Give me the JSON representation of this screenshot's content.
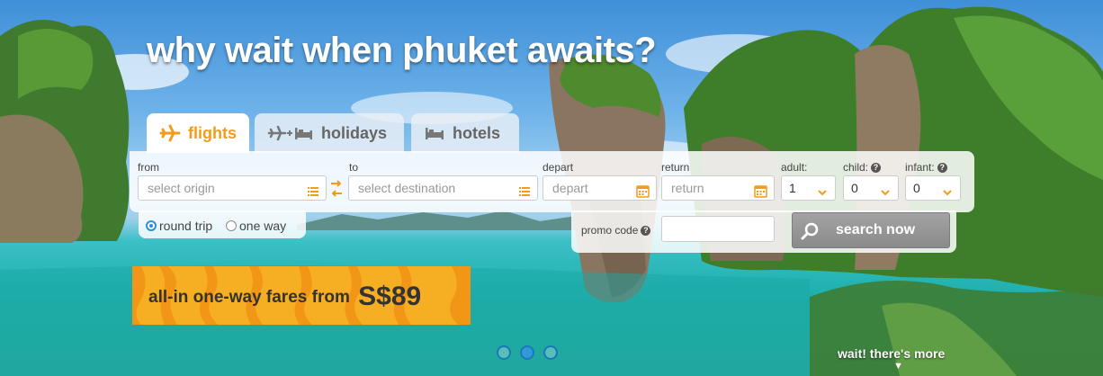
{
  "headline": "why wait when phuket awaits?",
  "tabs": [
    {
      "label": "flights",
      "icon": "plane-icon",
      "active": true
    },
    {
      "label": "holidays",
      "icon": "plane-bed-icon",
      "active": false
    },
    {
      "label": "hotels",
      "icon": "bed-icon",
      "active": false
    }
  ],
  "form": {
    "from_label": "from",
    "from_placeholder": "select origin",
    "to_label": "to",
    "to_placeholder": "select destination",
    "depart_label": "depart",
    "depart_placeholder": "depart",
    "return_label": "return",
    "return_placeholder": "return",
    "adult_label": "adult:",
    "adult_value": "1",
    "child_label": "child:",
    "child_value": "0",
    "infant_label": "infant:",
    "infant_value": "0",
    "help_glyph": "?",
    "trip_round": "round trip",
    "trip_oneway": "one way",
    "promo_label": "promo code",
    "search_label": "search now"
  },
  "banner": {
    "text": "all-in one-way fares from",
    "price": "S$89"
  },
  "carousel": {
    "count": 3,
    "active": 2
  },
  "more": {
    "label": "wait! there's more",
    "arrow": "▼"
  },
  "colors": {
    "accent": "#f39c1a",
    "banner": "#f6ae22",
    "button": "#999999",
    "dot_active": "#2f9ad6"
  }
}
